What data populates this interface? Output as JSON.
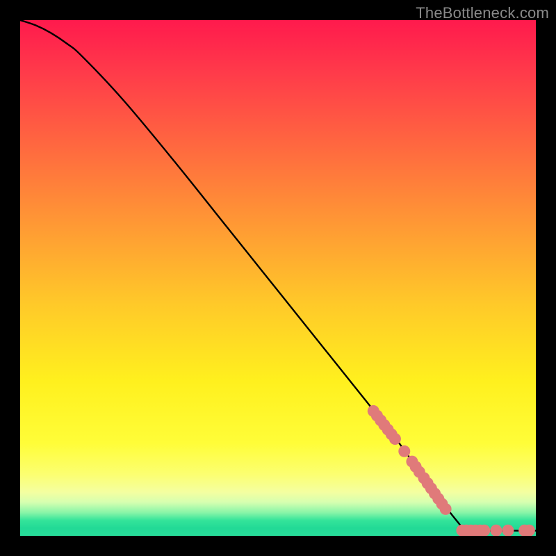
{
  "watermark": "TheBottleneck.com",
  "chart_data": {
    "type": "line",
    "title": "",
    "xlabel": "",
    "ylabel": "",
    "xlim": [
      0,
      100
    ],
    "ylim": [
      0,
      100
    ],
    "grid": false,
    "legend": false,
    "curve": [
      {
        "x": 0,
        "y": 100
      },
      {
        "x": 3,
        "y": 99
      },
      {
        "x": 6,
        "y": 97.5
      },
      {
        "x": 9,
        "y": 95.5
      },
      {
        "x": 12,
        "y": 93
      },
      {
        "x": 20,
        "y": 84.5
      },
      {
        "x": 30,
        "y": 72.5
      },
      {
        "x": 40,
        "y": 60
      },
      {
        "x": 50,
        "y": 47.5
      },
      {
        "x": 60,
        "y": 35
      },
      {
        "x": 68,
        "y": 25
      },
      {
        "x": 72,
        "y": 20
      },
      {
        "x": 76,
        "y": 14.5
      },
      {
        "x": 80,
        "y": 9
      },
      {
        "x": 83,
        "y": 5
      },
      {
        "x": 85,
        "y": 2.5
      },
      {
        "x": 86,
        "y": 1.3
      },
      {
        "x": 87,
        "y": 1.0
      },
      {
        "x": 90,
        "y": 1.0
      },
      {
        "x": 95,
        "y": 1.0
      },
      {
        "x": 100,
        "y": 1.0
      }
    ],
    "points": [
      {
        "x": 68.5,
        "y": 24.2
      },
      {
        "x": 69.2,
        "y": 23.3
      },
      {
        "x": 69.9,
        "y": 22.4
      },
      {
        "x": 70.6,
        "y": 21.5
      },
      {
        "x": 71.3,
        "y": 20.6
      },
      {
        "x": 72.0,
        "y": 19.7
      },
      {
        "x": 72.7,
        "y": 18.8
      },
      {
        "x": 74.5,
        "y": 16.4
      },
      {
        "x": 76.0,
        "y": 14.4
      },
      {
        "x": 76.7,
        "y": 13.4
      },
      {
        "x": 77.4,
        "y": 12.4
      },
      {
        "x": 78.3,
        "y": 11.2
      },
      {
        "x": 79.0,
        "y": 10.2
      },
      {
        "x": 79.7,
        "y": 9.2
      },
      {
        "x": 80.4,
        "y": 8.2
      },
      {
        "x": 81.1,
        "y": 7.2
      },
      {
        "x": 81.8,
        "y": 6.2
      },
      {
        "x": 82.5,
        "y": 5.2
      },
      {
        "x": 85.7,
        "y": 1.05
      },
      {
        "x": 86.5,
        "y": 1.05
      },
      {
        "x": 87.4,
        "y": 1.05
      },
      {
        "x": 88.3,
        "y": 1.05
      },
      {
        "x": 89.2,
        "y": 1.05
      },
      {
        "x": 90.0,
        "y": 1.05
      },
      {
        "x": 92.3,
        "y": 1.05
      },
      {
        "x": 94.6,
        "y": 1.05
      },
      {
        "x": 97.8,
        "y": 1.05
      },
      {
        "x": 98.7,
        "y": 1.05
      }
    ],
    "colors": {
      "curve": "#000000",
      "points_fill": "#e07a7a",
      "points_stroke": "#8f3a3a"
    },
    "point_radius": 8.5
  }
}
